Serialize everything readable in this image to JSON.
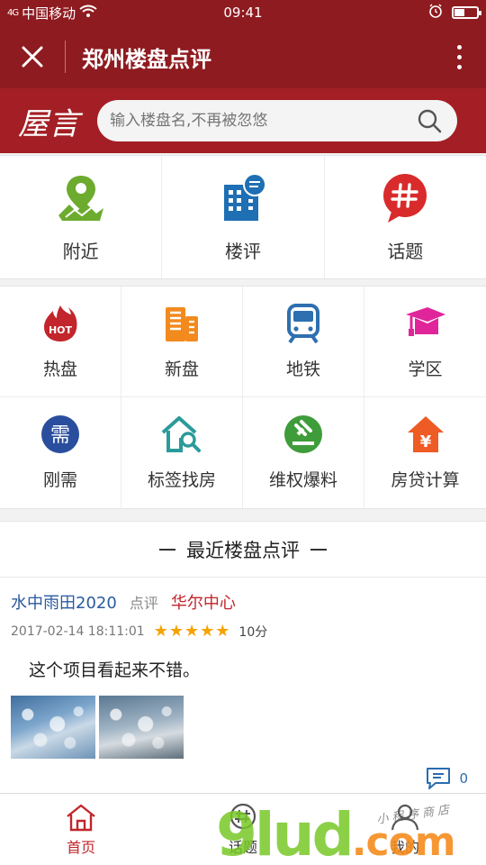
{
  "status": {
    "carrier": "中国移动",
    "signal": "4G",
    "time": "09:41",
    "battery_level": 0.45
  },
  "titlebar": {
    "title": "郑州楼盘点评"
  },
  "search": {
    "logo": "屋言",
    "placeholder": "输入楼盘名,不再被忽悠"
  },
  "top_nav": [
    {
      "label": "附近",
      "icon": "map-pin-icon",
      "color": "#6cab2e"
    },
    {
      "label": "楼评",
      "icon": "building-chat-icon",
      "color": "#1e6fb3"
    },
    {
      "label": "话题",
      "icon": "hashtag-chat-icon",
      "color": "#d92b2b"
    }
  ],
  "grid": [
    {
      "label": "热盘",
      "icon": "hot-flame-icon",
      "color": "#c2252b",
      "badge": "HOT"
    },
    {
      "label": "新盘",
      "icon": "new-building-icon",
      "color": "#f28a1e"
    },
    {
      "label": "地铁",
      "icon": "subway-icon",
      "color": "#2e6fb0"
    },
    {
      "label": "学区",
      "icon": "graduation-cap-icon",
      "color": "#e0259a"
    },
    {
      "label": "刚需",
      "icon": "need-character-icon",
      "color": "#2a4e9e",
      "badge": "需"
    },
    {
      "label": "标签找房",
      "icon": "house-search-icon",
      "color": "#2b9a9a"
    },
    {
      "label": "维权爆料",
      "icon": "gavel-icon",
      "color": "#3f9c3a"
    },
    {
      "label": "房贷计算",
      "icon": "house-yuan-icon",
      "color": "#ef5b24",
      "badge": "¥"
    }
  ],
  "recent": {
    "heading": "最近楼盘点评",
    "review": {
      "user": "水中雨田2020",
      "verb": "点评",
      "project": "华尔中心",
      "date": "2017-02-14 18:11:01",
      "stars": 5,
      "score": "10分",
      "content": "这个项目看起来不错。",
      "comment_count": "0"
    }
  },
  "bottom_nav": [
    {
      "label": "首页",
      "icon": "home-icon",
      "active": true
    },
    {
      "label": "话题",
      "icon": "topic-icon",
      "active": false
    },
    {
      "label": "我的",
      "icon": "user-icon",
      "active": false
    }
  ],
  "watermark": {
    "brand": "9lud",
    "tld": ".com",
    "small_text": "小程序商店"
  }
}
